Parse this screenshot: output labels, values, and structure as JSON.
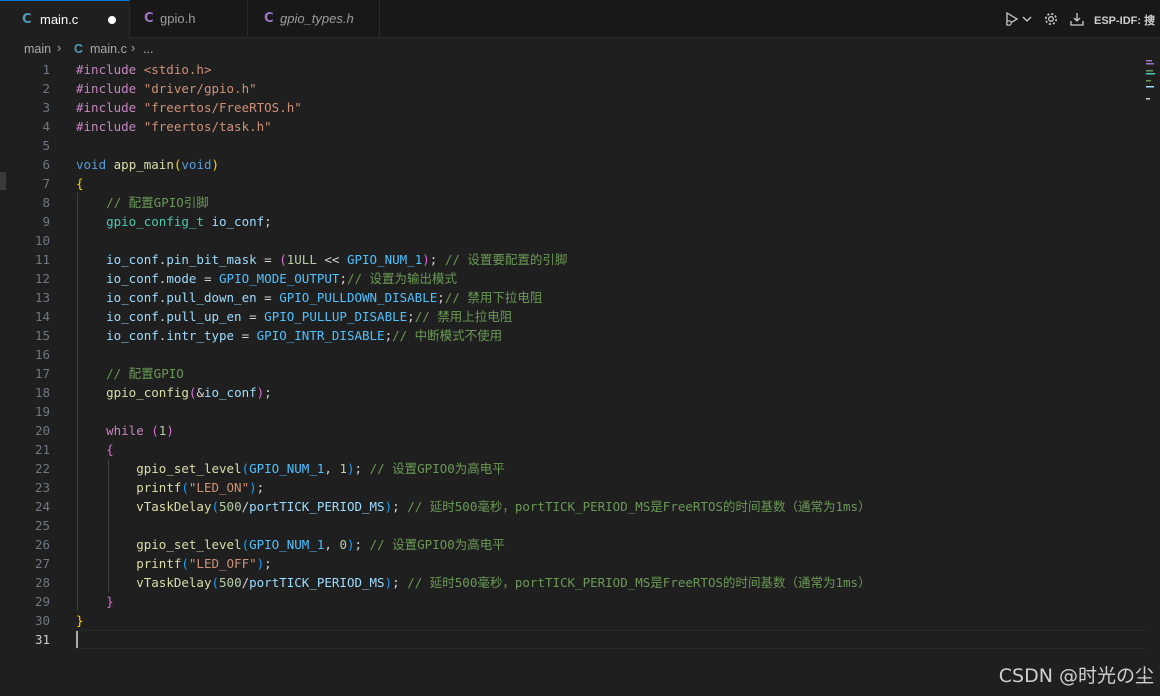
{
  "tabs": [
    {
      "icon": "C",
      "label": "main.c",
      "modified": true
    },
    {
      "icon": "C",
      "label": "gpio.h"
    },
    {
      "icon": "C",
      "label": "gpio_types.h"
    }
  ],
  "toolbar": {
    "esp_label": "ESP-IDF: 搜"
  },
  "breadcrumb": {
    "folder": "main",
    "icon": "C",
    "file": "main.c",
    "more": "..."
  },
  "line_numbers": [
    "1",
    "2",
    "3",
    "4",
    "5",
    "6",
    "7",
    "8",
    "9",
    "10",
    "11",
    "12",
    "13",
    "14",
    "15",
    "16",
    "17",
    "18",
    "19",
    "20",
    "21",
    "22",
    "23",
    "24",
    "25",
    "26",
    "27",
    "28",
    "29",
    "30",
    "31"
  ],
  "code_lines": [
    [
      [
        "pp",
        "#include "
      ],
      [
        "str",
        "<stdio.h>"
      ]
    ],
    [
      [
        "pp",
        "#include "
      ],
      [
        "str",
        "\"driver/gpio.h\""
      ]
    ],
    [
      [
        "pp",
        "#include "
      ],
      [
        "str",
        "\"freertos/FreeRTOS.h\""
      ]
    ],
    [
      [
        "pp",
        "#include "
      ],
      [
        "str",
        "\"freertos/task.h\""
      ]
    ],
    [],
    [
      [
        "kw",
        "void "
      ],
      [
        "fn",
        "app_main"
      ],
      [
        "b1",
        "("
      ],
      [
        "kw",
        "void"
      ],
      [
        "b1",
        ")"
      ]
    ],
    [
      [
        "b1",
        "{"
      ]
    ],
    [
      [
        "op",
        "    "
      ],
      [
        "cm",
        "// 配置GPIO引脚"
      ]
    ],
    [
      [
        "op",
        "    "
      ],
      [
        "ty",
        "gpio_config_t "
      ],
      [
        "var",
        "io_conf"
      ],
      [
        "op",
        ";"
      ]
    ],
    [],
    [
      [
        "op",
        "    "
      ],
      [
        "var",
        "io_conf"
      ],
      [
        "op",
        "."
      ],
      [
        "var",
        "pin_bit_mask"
      ],
      [
        "op",
        " = "
      ],
      [
        "b2",
        "("
      ],
      [
        "num",
        "1ULL"
      ],
      [
        "op",
        " << "
      ],
      [
        "mac",
        "GPIO_NUM_1"
      ],
      [
        "b2",
        ")"
      ],
      [
        "op",
        "; "
      ],
      [
        "cm",
        "// 设置要配置的引脚"
      ]
    ],
    [
      [
        "op",
        "    "
      ],
      [
        "var",
        "io_conf"
      ],
      [
        "op",
        "."
      ],
      [
        "var",
        "mode"
      ],
      [
        "op",
        " = "
      ],
      [
        "mac",
        "GPIO_MODE_OUTPUT"
      ],
      [
        "op",
        ";"
      ],
      [
        "cm",
        "// 设置为输出模式"
      ]
    ],
    [
      [
        "op",
        "    "
      ],
      [
        "var",
        "io_conf"
      ],
      [
        "op",
        "."
      ],
      [
        "var",
        "pull_down_en"
      ],
      [
        "op",
        " = "
      ],
      [
        "mac",
        "GPIO_PULLDOWN_DISABLE"
      ],
      [
        "op",
        ";"
      ],
      [
        "cm",
        "// 禁用下拉电阻"
      ]
    ],
    [
      [
        "op",
        "    "
      ],
      [
        "var",
        "io_conf"
      ],
      [
        "op",
        "."
      ],
      [
        "var",
        "pull_up_en"
      ],
      [
        "op",
        " = "
      ],
      [
        "mac",
        "GPIO_PULLUP_DISABLE"
      ],
      [
        "op",
        ";"
      ],
      [
        "cm",
        "// 禁用上拉电阻"
      ]
    ],
    [
      [
        "op",
        "    "
      ],
      [
        "var",
        "io_conf"
      ],
      [
        "op",
        "."
      ],
      [
        "var",
        "intr_type"
      ],
      [
        "op",
        " = "
      ],
      [
        "mac",
        "GPIO_INTR_DISABLE"
      ],
      [
        "op",
        ";"
      ],
      [
        "cm",
        "// 中断模式不使用"
      ]
    ],
    [],
    [
      [
        "op",
        "    "
      ],
      [
        "cm",
        "// 配置GPIO"
      ]
    ],
    [
      [
        "op",
        "    "
      ],
      [
        "fn",
        "gpio_config"
      ],
      [
        "b2",
        "("
      ],
      [
        "op",
        "&"
      ],
      [
        "var",
        "io_conf"
      ],
      [
        "b2",
        ")"
      ],
      [
        "op",
        ";"
      ]
    ],
    [],
    [
      [
        "op",
        "    "
      ],
      [
        "pp",
        "while "
      ],
      [
        "b2",
        "("
      ],
      [
        "num",
        "1"
      ],
      [
        "b2",
        ")"
      ]
    ],
    [
      [
        "op",
        "    "
      ],
      [
        "b2",
        "{"
      ]
    ],
    [
      [
        "op",
        "        "
      ],
      [
        "fn",
        "gpio_set_level"
      ],
      [
        "b3",
        "("
      ],
      [
        "mac",
        "GPIO_NUM_1"
      ],
      [
        "op",
        ", "
      ],
      [
        "num",
        "1"
      ],
      [
        "b3",
        ")"
      ],
      [
        "op",
        "; "
      ],
      [
        "cm",
        "// 设置GPIO0为高电平"
      ]
    ],
    [
      [
        "op",
        "        "
      ],
      [
        "fn",
        "printf"
      ],
      [
        "b3",
        "("
      ],
      [
        "str",
        "\"LED_ON\""
      ],
      [
        "b3",
        ")"
      ],
      [
        "op",
        ";"
      ]
    ],
    [
      [
        "op",
        "        "
      ],
      [
        "fn",
        "vTaskDelay"
      ],
      [
        "b3",
        "("
      ],
      [
        "num",
        "500"
      ],
      [
        "op",
        "/"
      ],
      [
        "var",
        "portTICK_PERIOD_MS"
      ],
      [
        "b3",
        ")"
      ],
      [
        "op",
        "; "
      ],
      [
        "cm",
        "// 延时500毫秒，portTICK_PERIOD_MS是FreeRTOS的时间基数（通常为1ms）"
      ]
    ],
    [],
    [
      [
        "op",
        "        "
      ],
      [
        "fn",
        "gpio_set_level"
      ],
      [
        "b3",
        "("
      ],
      [
        "mac",
        "GPIO_NUM_1"
      ],
      [
        "op",
        ", "
      ],
      [
        "num",
        "0"
      ],
      [
        "b3",
        ")"
      ],
      [
        "op",
        "; "
      ],
      [
        "cm",
        "// 设置GPIO0为高电平"
      ]
    ],
    [
      [
        "op",
        "        "
      ],
      [
        "fn",
        "printf"
      ],
      [
        "b3",
        "("
      ],
      [
        "str",
        "\"LED_OFF\""
      ],
      [
        "b3",
        ")"
      ],
      [
        "op",
        ";"
      ]
    ],
    [
      [
        "op",
        "        "
      ],
      [
        "fn",
        "vTaskDelay"
      ],
      [
        "b3",
        "("
      ],
      [
        "num",
        "500"
      ],
      [
        "op",
        "/"
      ],
      [
        "var",
        "portTICK_PERIOD_MS"
      ],
      [
        "b3",
        ")"
      ],
      [
        "op",
        "; "
      ],
      [
        "cm",
        "// 延时500毫秒，portTICK_PERIOD_MS是FreeRTOS的时间基数（通常为1ms）"
      ]
    ],
    [
      [
        "op",
        "    "
      ],
      [
        "b2",
        "}"
      ]
    ],
    [
      [
        "b1",
        "}"
      ]
    ],
    []
  ],
  "current_line": 31,
  "watermark": "CSDN @时光の尘"
}
